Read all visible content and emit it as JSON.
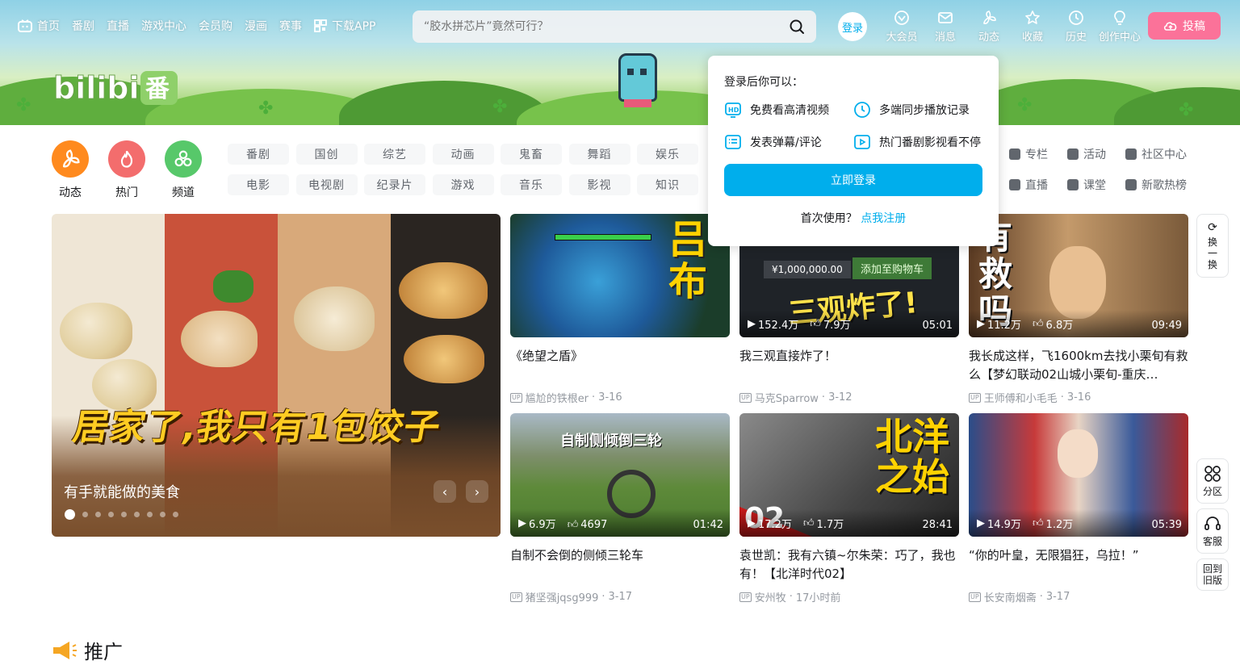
{
  "top_nav": {
    "left_items": [
      "首页",
      "番剧",
      "直播",
      "游戏中心",
      "会员购",
      "漫画",
      "赛事",
      "下载APP"
    ],
    "search_placeholder": "“胶水拼芯片”竟然可行？",
    "login_label": "登录",
    "right_items": [
      "大会员",
      "消息",
      "动态",
      "收藏",
      "历史",
      "创作中心"
    ],
    "upload_label": "投稿"
  },
  "category_icons": [
    {
      "label": "动态",
      "color": "#ff8a1e"
    },
    {
      "label": "热门",
      "color": "#f36d6d"
    },
    {
      "label": "频道",
      "color": "#57c86a"
    }
  ],
  "category_tags": [
    "番剧",
    "国创",
    "综艺",
    "动画",
    "鬼畜",
    "舞蹈",
    "娱乐",
    "电影",
    "电视剧",
    "纪录片",
    "游戏",
    "音乐",
    "影视",
    "知识"
  ],
  "quick_links": [
    "专栏",
    "活动",
    "社区中心",
    "直播",
    "课堂",
    "新歌热榜"
  ],
  "carousel": {
    "overlay_title": "居家了,我只有1包饺子",
    "caption": "有手就能做的美食",
    "dot_count": 9,
    "active_dot": 0
  },
  "videos": [
    {
      "title": "《绝望之盾》",
      "author": "尴尬的铁根er",
      "date": "3-16",
      "thumb_text": "吕布"
    },
    {
      "title": "我三观直接炸了！",
      "author": "马克Sparrow",
      "date": "3-12",
      "views": "152.4万",
      "likes": "7.9万",
      "duration": "05:01",
      "thumb_text": "三观炸了!",
      "thumb_extra": "¥1,000,000.00",
      "thumb_btn": "添加至购物车"
    },
    {
      "title": "我长成这样，飞1600km去找小栗旬有救么【梦幻联动02山城小栗旬-重庆…",
      "author": "王师傅和小毛毛",
      "date": "3-16",
      "views": "11.2万",
      "likes": "6.8万",
      "duration": "09:49",
      "thumb_text": "有救吗"
    },
    {
      "title": "自制不会倒的侧倾三轮车",
      "author": "猪坚强jqsg999",
      "date": "3-17",
      "views": "6.9万",
      "likes": "4697",
      "duration": "01:42",
      "thumb_text": "自制侧倾倒三轮"
    },
    {
      "title": "袁世凯：我有六镇~尔朱荣：巧了，我也有！【北洋时代02】",
      "author": "安州牧",
      "date": "17小时前",
      "views": "17.2万",
      "likes": "1.7万",
      "duration": "28:41",
      "thumb_text": "北洋之始",
      "thumb_num": "02"
    },
    {
      "title": "“你的叶皇，无限猖狂，乌拉！”",
      "author": "长安南烟斋",
      "date": "3-17",
      "views": "14.9万",
      "likes": "1.2万",
      "duration": "05:39"
    }
  ],
  "login_popup": {
    "header": "登录后你可以：",
    "features": [
      "免费看高清视频",
      "多端同步播放记录",
      "发表弹幕/评论",
      "热门番剧影视看不停"
    ],
    "button": "立即登录",
    "register_prompt": "首次使用？",
    "register_link": "点我注册"
  },
  "side_buttons": {
    "refresh": "换一换",
    "zone": "分区",
    "service": "客服",
    "old": "回到旧版"
  },
  "promo_title": "推广",
  "colors": {
    "accent": "#00aeec",
    "pink": "#fb7299"
  }
}
